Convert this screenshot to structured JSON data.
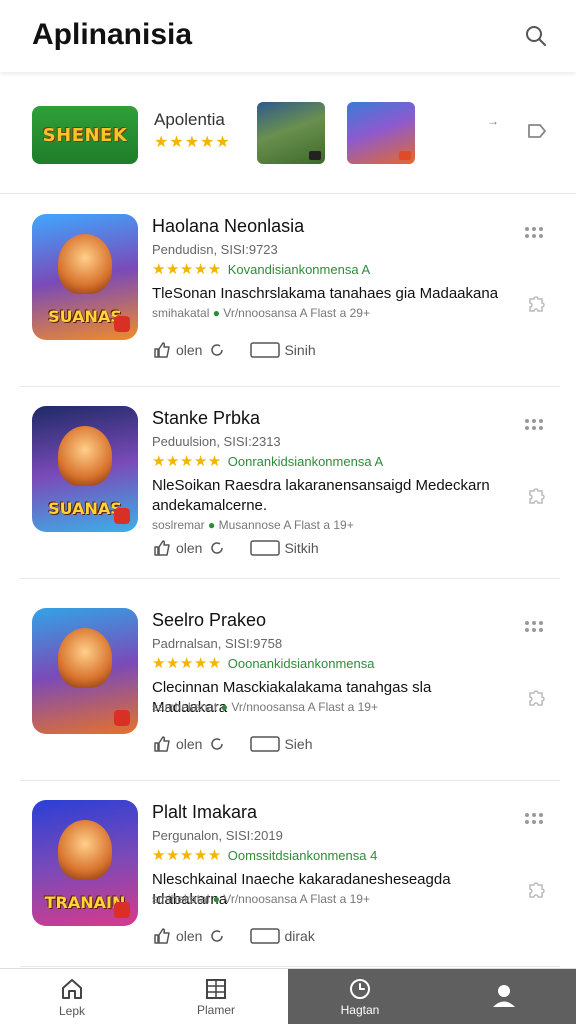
{
  "header": {
    "title": "Aplinanisia"
  },
  "featured": {
    "logo_text": "SHENEK",
    "name": "Apolentia",
    "stars": "★★★★★",
    "arrow": "→"
  },
  "items": [
    {
      "title": "Haolana Neonlasia",
      "subtitle": "Pendudisn, SISI:9723",
      "stars": "★★★★★",
      "rating_text": "Kovandisiankonmensa A",
      "description": "TleSonan Inaschrslakama tanahaes gia Madaakana",
      "meta": "smihakatal",
      "meta_extra": "Vr/nnoosansa A Flast a 29+",
      "icon_word": "SUANAS",
      "like_label": "olen",
      "share_label": "Sinih",
      "colors": {
        "top": "#3fa7ff",
        "bottom": "#f08c2a"
      }
    },
    {
      "title": "Stanke Prbka",
      "subtitle": "Peduulsion, SISI:2313",
      "stars": "★★★★★",
      "rating_text": "Oonrankidsiankonmensa A",
      "description": "NleSoikan Raesdra lakaranensansaigd Medeckarn andekamalcerne.",
      "meta": "soslremar",
      "meta_extra": "Musannose A Flast a 19+",
      "icon_word": "SUANAS",
      "like_label": "olen",
      "share_label": "Sitkih",
      "colors": {
        "top": "#1e2a66",
        "bottom": "#3db0e8"
      }
    },
    {
      "title": "Seelro Prakeo",
      "subtitle": "Padrnalsan, SISI:9758",
      "stars": "★★★★★",
      "rating_text": "Ooonankidsiankonmensa",
      "description": "Clecinnan Masckiakalakama tanahgas sla Madaakara",
      "meta": "samhekanat",
      "meta_extra": "Vr/nnoosansa A Flast a 19+",
      "icon_word": "",
      "like_label": "olen",
      "share_label": "Sieh",
      "colors": {
        "top": "#33a3e6",
        "bottom": "#e6722a"
      }
    },
    {
      "title": "Plalt Imakara",
      "subtitle": "Pergunalon, SISI:2019",
      "stars": "★★★★★",
      "rating_text": "Oomssitdsiankonmensa 4",
      "description": "Nleschkainal Inaeche kakaradanesheseagda Idabakarna",
      "meta": "smihekatal",
      "meta_extra": "Vr/nnoosansa A Flast a 19+",
      "icon_word": "TRANAIN",
      "like_label": "olen",
      "share_label": "dirak",
      "colors": {
        "top": "#2a3fd6",
        "bottom": "#d63a8c"
      }
    }
  ],
  "bottom_nav": [
    {
      "label": "Lepk",
      "icon": "home-icon"
    },
    {
      "label": "Plamer",
      "icon": "grid-icon"
    },
    {
      "label": "Hagtan",
      "icon": "clock-icon"
    },
    {
      "label": "",
      "icon": "profile-icon"
    }
  ]
}
